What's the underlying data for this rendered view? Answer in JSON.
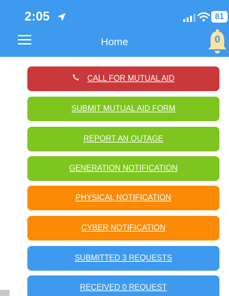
{
  "status_bar": {
    "time": "2:05",
    "battery": "81"
  },
  "header": {
    "title": "Home",
    "notification_count": "0"
  },
  "buttons": [
    {
      "label": "CALL FOR MUTUAL AID",
      "color": "#c9393b",
      "icon": "phone-icon"
    },
    {
      "label": "SUBMIT MUTUAL AID FORM",
      "color": "#7ec51f"
    },
    {
      "label": "REPORT AN OUTAGE",
      "color": "#7ec51f"
    },
    {
      "label": "GENERATION NOTIFICATION",
      "color": "#7ec51f"
    },
    {
      "label": "PHYSICAL NOTIFICATION",
      "color": "#fd8a07"
    },
    {
      "label": "CYBER NOTIFICATION",
      "color": "#fd8a07"
    },
    {
      "label": "SUBMITTED 3 REQUESTS",
      "color": "#3e9aee"
    },
    {
      "label": "RECEIVED 0 REQUEST",
      "color": "#3e9aee"
    }
  ],
  "colors": {
    "app_bar": "#3e9aee",
    "bell": "#fde3a0"
  }
}
